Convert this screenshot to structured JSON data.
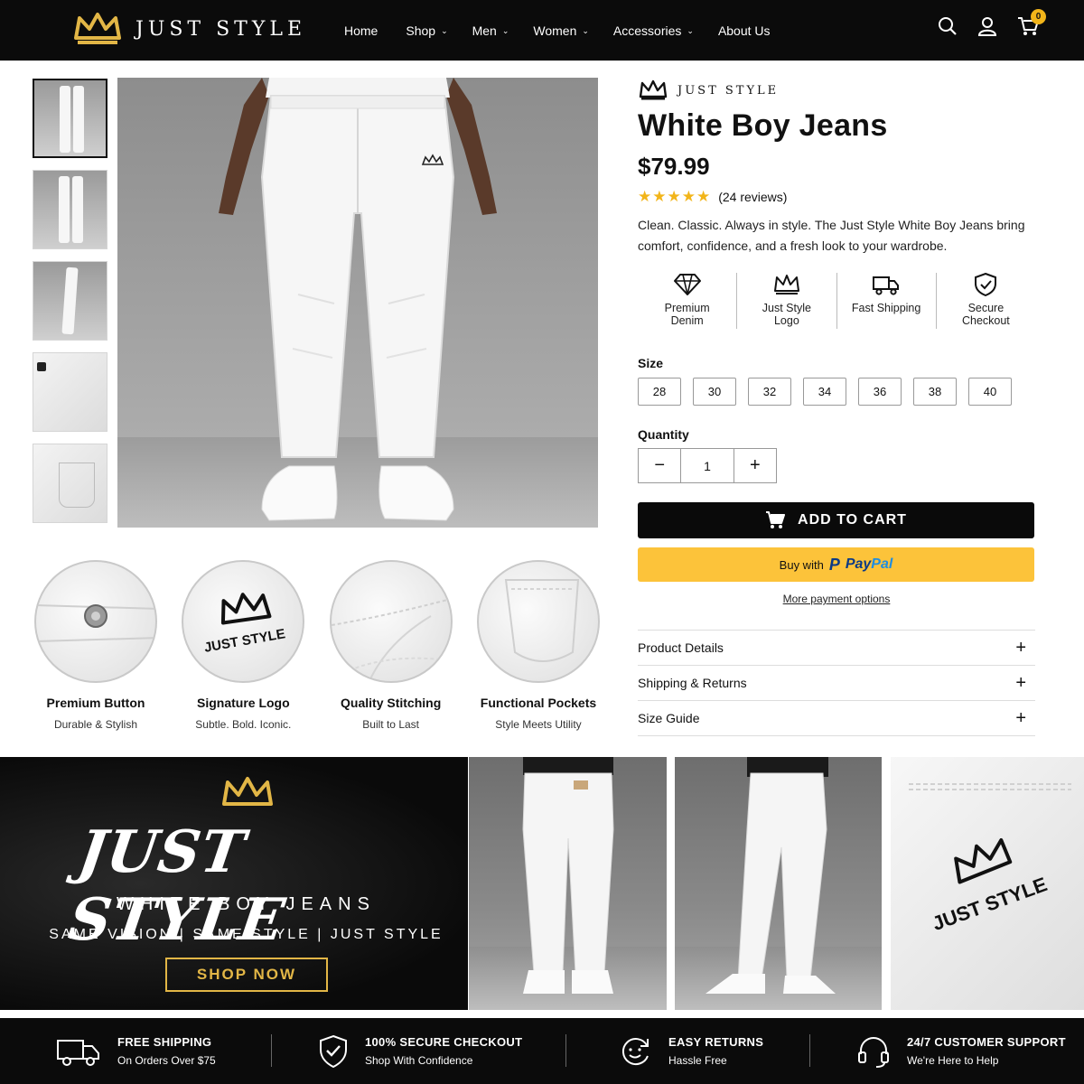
{
  "header": {
    "brand": "JUST STYLE",
    "nav": [
      {
        "label": "Home",
        "dropdown": false
      },
      {
        "label": "Shop",
        "dropdown": true
      },
      {
        "label": "Men",
        "dropdown": true
      },
      {
        "label": "Women",
        "dropdown": true
      },
      {
        "label": "Accessories",
        "dropdown": true
      },
      {
        "label": "About Us",
        "dropdown": false
      }
    ],
    "cart_count": "0",
    "icons": [
      "search-icon",
      "user-icon",
      "cart-icon"
    ]
  },
  "product": {
    "brand": "JUST STYLE",
    "title": "White Boy Jeans",
    "price": "$79.99",
    "rating": 5,
    "reviews": "(24 reviews)",
    "description": "Clean. Classic. Always in style. The Just Style White Boy Jeans bring comfort, confidence, and a fresh look to your wardrobe.",
    "features": [
      {
        "icon": "diamond-icon",
        "label": "Premium Denim"
      },
      {
        "icon": "crown-icon",
        "label": "Just Style Logo"
      },
      {
        "icon": "truck-icon",
        "label": "Fast Shipping"
      },
      {
        "icon": "shield-check-icon",
        "label": "Secure Checkout"
      }
    ],
    "size_label": "Size",
    "sizes": [
      "28",
      "30",
      "32",
      "34",
      "36",
      "38",
      "40"
    ],
    "quantity_label": "Quantity",
    "quantity": "1",
    "add_to_cart": "ADD TO CART",
    "paypal_prefix": "Buy with",
    "paypal_brand_1": "Pay",
    "paypal_brand_2": "Pal",
    "more_payment": "More payment options",
    "accordions": [
      "Product Details",
      "Shipping & Returns",
      "Size Guide"
    ]
  },
  "details": [
    {
      "title": "Premium Button",
      "sub": "Durable & Stylish"
    },
    {
      "title": "Signature Logo",
      "sub": "Subtle. Bold. Iconic.",
      "logo_text": "JUST STYLE"
    },
    {
      "title": "Quality Stitching",
      "sub": "Built to Last"
    },
    {
      "title": "Functional Pockets",
      "sub": "Style Meets Utility"
    }
  ],
  "banner": {
    "title": "JUST STYLE",
    "subtitle": "WHITE BOY JEANS",
    "tagline": "SAME VISION  |  SAME STYLE  |  JUST STYLE",
    "cta": "SHOP NOW",
    "closeup_logo_text": "JUST STYLE"
  },
  "trust": [
    {
      "icon": "truck-icon",
      "title": "FREE SHIPPING",
      "sub": "On Orders Over $75"
    },
    {
      "icon": "shield-check-icon",
      "title": "100% SECURE CHECKOUT",
      "sub": "Shop With Confidence"
    },
    {
      "icon": "returns-icon",
      "title": "EASY RETURNS",
      "sub": "Hassle Free"
    },
    {
      "icon": "headset-icon",
      "title": "24/7 CUSTOMER SUPPORT",
      "sub": "We're Here to Help"
    }
  ],
  "colors": {
    "gold": "#e2b646",
    "star": "#f2b51a",
    "black": "#0b0b0b",
    "paypal": "#fcc33a"
  }
}
